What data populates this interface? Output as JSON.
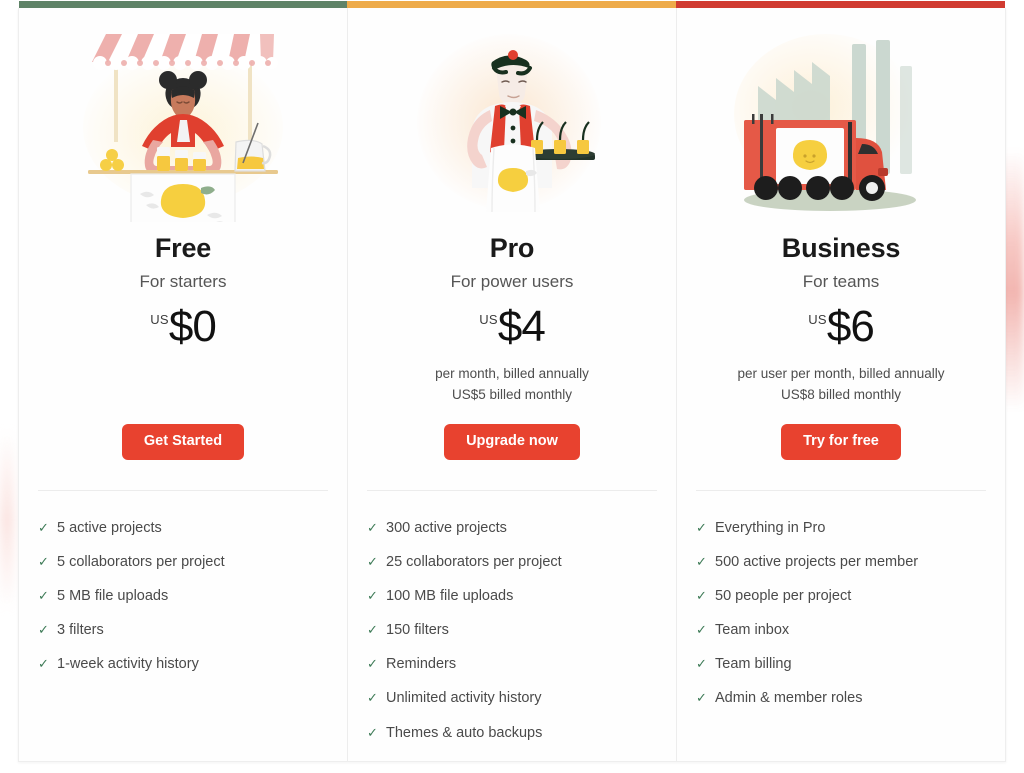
{
  "page": {
    "background_color": "#ffffff",
    "card_background": "#fefefe",
    "cta_color": "#e8422f",
    "check_color": "#3d7a56"
  },
  "plans": [
    {
      "accent_color": "#5f8367",
      "illustration": "lemonade-stand-illustration",
      "name": "Free",
      "tagline": "For starters",
      "price_currency": "US",
      "price_amount": "$0",
      "billing_line_1": "",
      "billing_line_2": "",
      "cta_label": "Get Started",
      "features": [
        "5 active projects",
        "5 collaborators per project",
        "5 MB file uploads",
        "3 filters",
        "1-week activity history"
      ]
    },
    {
      "accent_color": "#eeab4a",
      "illustration": "waiter-with-tray-illustration",
      "name": "Pro",
      "tagline": "For power users",
      "price_currency": "US",
      "price_amount": "$4",
      "billing_line_1": "per month, billed annually",
      "billing_line_2": "US$5 billed monthly",
      "cta_label": "Upgrade now",
      "features": [
        "300 active projects",
        "25 collaborators per project",
        "100 MB file uploads",
        "150 filters",
        "Reminders",
        "Unlimited activity history",
        "Themes & auto backups"
      ]
    },
    {
      "accent_color": "#d13b31",
      "illustration": "delivery-truck-illustration",
      "name": "Business",
      "tagline": "For teams",
      "price_currency": "US",
      "price_amount": "$6",
      "billing_line_1": "per user per month, billed annually",
      "billing_line_2": "US$8 billed monthly",
      "cta_label": "Try for free",
      "features": [
        "Everything in Pro",
        "500 active projects per member",
        "50 people per project",
        "Team inbox",
        "Team billing",
        "Admin & member roles"
      ]
    }
  ],
  "icons": {
    "check": "✓"
  }
}
